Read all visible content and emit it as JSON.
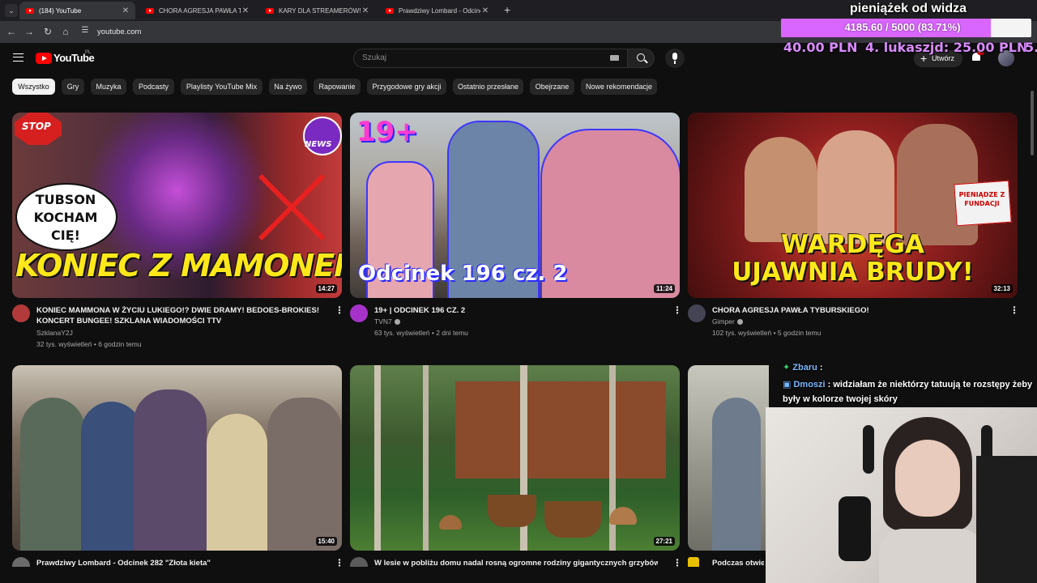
{
  "browser": {
    "tabs": [
      {
        "title": "(184) YouTube",
        "active": true
      },
      {
        "title": "CHORA AGRESJA PAWŁA TYBURSKIEGO",
        "active": false
      },
      {
        "title": "KARY DLA STREAMERÓW! AWANTURA",
        "active": false
      },
      {
        "title": "Prawdziwy Lombard - Odcinek",
        "active": false
      }
    ],
    "url": "youtube.com"
  },
  "youtube": {
    "logo_text": "YouTube",
    "country_code": "PL",
    "search_placeholder": "Szukaj",
    "create_label": "Utwórz",
    "notification_count": "9+",
    "chips": [
      "Wszystko",
      "Gry",
      "Muzyka",
      "Podcasty",
      "Playlisty YouTube Mix",
      "Na żywo",
      "Rapowanie",
      "Przygodowe gry akcji",
      "Ostatnio przesłane",
      "Obejrzane",
      "Nowe rekomendacje"
    ],
    "videos": [
      {
        "title_line1": "KONIEC MAMMONA W ŻYCIU LUKIEGO!? DWIE DRAMY! BEDOES-BROKIES!",
        "title_line2": "KONCERT BUNGEE! SZKLANA WIADOMOŚCI TTV",
        "channel": "SzklanaY2J",
        "stats": "32 tys. wyświetleń • 6 godzin temu",
        "duration": "14:27",
        "thumb_texts": {
          "bubble": "TUBSON KOCHAM CIĘ!",
          "banner": "KONIEC Z MAMONEM?",
          "stop": "STOP",
          "news": "NEWS"
        },
        "avatar_color": "#b33a3a"
      },
      {
        "title_line1": "19+ | ODCINEK 196 CZ. 2",
        "title_line2": "",
        "channel": "TVN7",
        "stats": "63 tys. wyświetleń • 2 dni temu",
        "duration": "11:24",
        "thumb_texts": {
          "badge": "19+",
          "banner": "Odcinek 196 cz. 2"
        },
        "avatar_color": "#a633c9"
      },
      {
        "title_line1": "CHORA AGRESJA PAWŁA TYBURSKIEGO!",
        "title_line2": "",
        "channel": "Gimper",
        "stats": "102 tys. wyświetleń • 5 godzin temu",
        "duration": "32:13",
        "thumb_texts": {
          "line1": "WARDĘGA",
          "line2": "UJAWNIA BRUDY!",
          "sign": "PIENIĄDZE Z FUNDACJI"
        },
        "avatar_color": "#444455"
      },
      {
        "title_line1": "Prawdziwy Lombard - Odcinek 282 \"Złota kieta\"",
        "channel": "",
        "duration": "15:40",
        "avatar_color": "#6b6b6b"
      },
      {
        "title_line1": "W lesie w pobliżu domu nadal rosną ogromne rodziny gigantycznych grzybów",
        "channel": "",
        "duration": "27:21",
        "avatar_color": "#5c5c5c"
      },
      {
        "title_line1": "Podczas otwie",
        "channel": "",
        "duration": "",
        "avatar_color": "#e8c000"
      }
    ]
  },
  "stream_overlay": {
    "donation_title": "pieniążek od widza",
    "donation_progress_text": "4185.60 / 5000 (83.71%)",
    "donation_progress": 0.8371,
    "ticker": [
      {
        "text": "40.00 PLN",
        "color": "#d98aff"
      },
      {
        "text": "4. lukaszjd: 25.00 PLN",
        "color": "#d98aff"
      },
      {
        "text": "5.",
        "color": "#d98aff"
      }
    ],
    "chat": [
      {
        "user": "Zbaru",
        "message": ":"
      },
      {
        "user": "Dmoszi",
        "message": ": widziałam że niektórzy tatuują te rozstępy żeby były w kolorze twojej skóry"
      }
    ]
  },
  "colors": {
    "accent": "#ff0000",
    "donation_fill": "#d966ff",
    "background": "#0f0f0f"
  }
}
